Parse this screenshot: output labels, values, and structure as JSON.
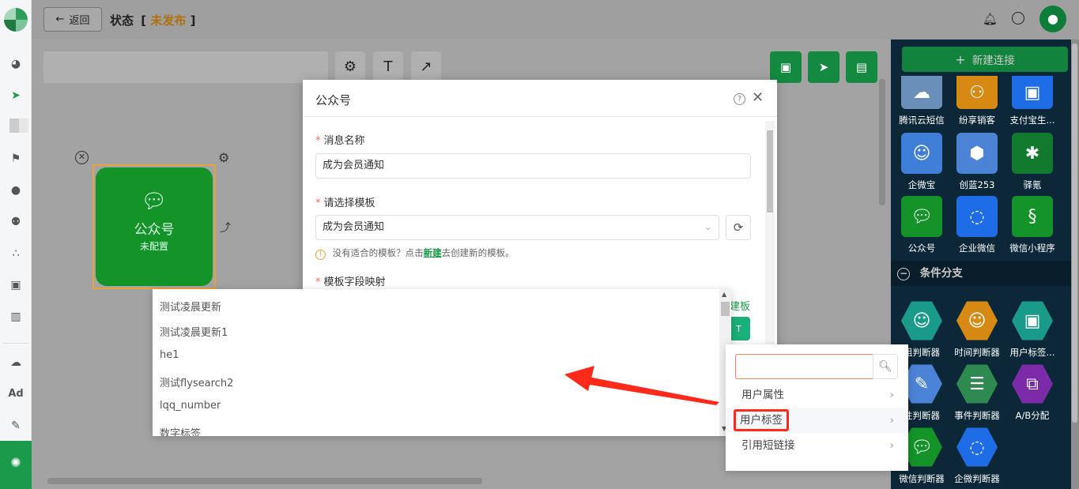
{
  "header": {
    "back_label": "返回",
    "title": "状态",
    "status_open": "[",
    "status": "未发布",
    "status_close": "]"
  },
  "sidebar": {
    "icons": [
      "dashboard-icon",
      "send-icon",
      "grid-icon",
      "flag-icon",
      "user-icon",
      "users-icon",
      "cluster-icon",
      "bookmark-icon",
      "bar-chart-icon",
      "wechat-icon",
      "ad-icon",
      "wrench-icon",
      "settings-active-icon"
    ],
    "ad_text": "Ad"
  },
  "canvas_toolbar": {
    "text_tool": "T",
    "arrow_tool": "↗"
  },
  "canvas_node": {
    "title": "公众号",
    "subtitle": "未配置"
  },
  "right_panel": {
    "new_connection_label": "新建连接",
    "nodes_row1": [
      "腾讯云短信",
      "纷享销客",
      "支付宝生..."
    ],
    "nodes_row2": [
      "企微宝",
      "创蓝253",
      "驿氪"
    ],
    "nodes_row3": [
      "公众号",
      "企业微信",
      "微信小程序"
    ],
    "section_title": "条件分支",
    "branch_row1": [
      "组判断器",
      "时间判断器",
      "用户标签..."
    ],
    "branch_row2": [
      "性判断器",
      "事件判断器",
      "A/B分配"
    ],
    "branch_row3": [
      "微信判断器",
      "企微判断器"
    ]
  },
  "modal": {
    "title": "公众号",
    "field1_label": "消息名称",
    "field1_value": "成为会员通知",
    "field2_label": "请选择模板",
    "field2_value": "成为会员通知",
    "hint_prefix": "没有适合的模板？点击",
    "hint_link": "新建",
    "hint_suffix": "去创建新的模板。",
    "field3_label": "模板字段映射",
    "peek_link": "建板"
  },
  "dropdown": {
    "options": [
      "测试凌晨更新",
      "测试凌晨更新1",
      "he1",
      "测试flysearch2",
      "lqq_number",
      "数字标签"
    ]
  },
  "cascader": {
    "search_placeholder": "",
    "items": [
      "用户属性",
      "用户标签",
      "引用短链接"
    ],
    "highlighted": "用户标签"
  },
  "colors": {
    "brand_green": "#1a9a4a",
    "node_green": "#149428",
    "status_orange": "#e6a23c",
    "highlight_red": "#ff2a1a"
  }
}
